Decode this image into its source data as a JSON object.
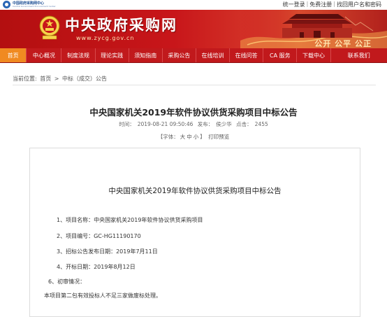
{
  "topbar": {
    "org_name_cn": "中国政府采购网中心",
    "org_name_en": "Central Government Procurement Center",
    "links": [
      "统一登录",
      "免费注册",
      "找回用户名和密码"
    ]
  },
  "banner": {
    "title": "中央政府采购网",
    "url": "www.zycg.gov.cn",
    "slogan": "公开  公平  公正",
    "colors": {
      "banner_red": "#c1191c",
      "accent_orange": "#f08a21",
      "gold": "#f7d34a"
    }
  },
  "nav": {
    "items": [
      "首页",
      "中心概况",
      "制度法规",
      "理论实践",
      "须知指南",
      "采购公告",
      "在线培训",
      "在线问答",
      "CA 服务",
      "下载中心",
      "联系我们"
    ],
    "active_index": 0
  },
  "breadcrumb": {
    "prefix": "当前位置:",
    "items": [
      "首页",
      "中标（成交）公告"
    ],
    "separator": ">"
  },
  "article": {
    "title": "中央国家机关2019年软件协议供货采购项目中标公告",
    "meta": {
      "time_label": "时间：",
      "time": "2019-08-21 09:50:46",
      "author_label": "发布：",
      "author": "侯少华",
      "clicks_label": "点击：",
      "clicks": "2455"
    },
    "tools": {
      "font_label": "【字体：",
      "sizes": [
        "大",
        "中",
        "小"
      ],
      "font_end": "】",
      "print": "打印预览"
    }
  },
  "content": {
    "title": "中央国家机关2019年软件协议供货采购项目中标公告",
    "items": [
      "1、项目名称：中央国家机关2019年软件协议供货采购项目",
      "2、项目编号：GC-HG11190170",
      "3、招标公告发布日期：2019年7月11日",
      "4、开标日期：2019年8月12日",
      "6、初审情况：",
      "本项目第二包有效投标人不足三家做废标处理。"
    ]
  }
}
